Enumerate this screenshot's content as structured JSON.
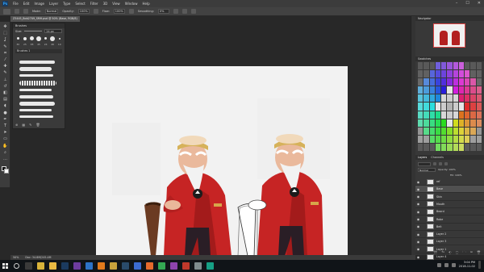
{
  "app": {
    "logo": "Ps"
  },
  "menu": [
    "File",
    "Edit",
    "Image",
    "Layer",
    "Type",
    "Select",
    "Filter",
    "3D",
    "View",
    "Window",
    "Help"
  ],
  "window_controls": {
    "minimize": "–",
    "maximize": "☐",
    "close": "✕"
  },
  "options": {
    "mode_label": "Mode:",
    "mode_value": "Normal",
    "opacity_label": "Opacity:",
    "opacity_value": "100%",
    "flow_label": "Flow:",
    "flow_value": "100%",
    "smoothing_label": "Smoothing:",
    "smoothing_value": "0%"
  },
  "document": {
    "tab_title": "Z3445_Bob2709_SMH.psd @ 50% (Base, RGB/8)"
  },
  "tools": [
    {
      "name": "move-tool-icon",
      "glyph": "✥"
    },
    {
      "name": "marquee-tool-icon",
      "glyph": "⬚"
    },
    {
      "name": "lasso-tool-icon",
      "glyph": "ʆ"
    },
    {
      "name": "quick-select-tool-icon",
      "glyph": "✎"
    },
    {
      "name": "crop-tool-icon",
      "glyph": "⌗"
    },
    {
      "name": "eyedropper-tool-icon",
      "glyph": "⁄"
    },
    {
      "name": "healing-tool-icon",
      "glyph": "✚"
    },
    {
      "name": "brush-tool-icon",
      "glyph": "✎"
    },
    {
      "name": "clone-stamp-tool-icon",
      "glyph": "⊥"
    },
    {
      "name": "history-brush-tool-icon",
      "glyph": "↺"
    },
    {
      "name": "eraser-tool-icon",
      "glyph": "◧"
    },
    {
      "name": "gradient-tool-icon",
      "glyph": "▤"
    },
    {
      "name": "blur-tool-icon",
      "glyph": "◖"
    },
    {
      "name": "dodge-tool-icon",
      "glyph": "●"
    },
    {
      "name": "pen-tool-icon",
      "glyph": "✒"
    },
    {
      "name": "type-tool-icon",
      "glyph": "T"
    },
    {
      "name": "path-select-tool-icon",
      "glyph": "➤"
    },
    {
      "name": "shape-tool-icon",
      "glyph": "▭"
    },
    {
      "name": "hand-tool-icon",
      "glyph": "✋"
    },
    {
      "name": "zoom-tool-icon",
      "glyph": "⌕"
    },
    {
      "name": "more-tools-icon",
      "glyph": "…"
    }
  ],
  "brushes_panel": {
    "title": "Brushes",
    "size_label": "Size:",
    "size_value": "24 px",
    "tip_sizes": [
      "30",
      "25",
      "38",
      "45",
      "24",
      "46",
      "10"
    ],
    "group_name": "Brushes 1",
    "footer": [
      "⊕",
      "▦",
      "✎",
      "🗑"
    ]
  },
  "right_panels": {
    "navigator_title": "Navigator",
    "swatches_title": "Swatches",
    "layers_tab": "Layers",
    "channels_tab": "Channels",
    "blend_mode": "Normal",
    "opacity_label": "Opacity: 100%",
    "fill_label": "Fill: 100%",
    "layers": [
      {
        "name": "ref",
        "selected": false
      },
      {
        "name": "Base",
        "selected": true
      },
      {
        "name": "Skin",
        "selected": false
      },
      {
        "name": "Mouth",
        "selected": false
      },
      {
        "name": "Beard",
        "selected": false
      },
      {
        "name": "Robe",
        "selected": false
      },
      {
        "name": "Belt",
        "selected": false
      },
      {
        "name": "Layer 2",
        "selected": false
      },
      {
        "name": "Layer 3",
        "selected": false
      },
      {
        "name": "Layer 1",
        "selected": false
      },
      {
        "name": "Layer 4",
        "selected": false
      }
    ],
    "footer_icons": [
      "⛓",
      "fx",
      "◐",
      "▢",
      "🗀",
      "⊞",
      "🗑"
    ]
  },
  "status": {
    "zoom": "50%",
    "doc_size": "Doc: 34.8M/245.4M"
  },
  "taskbar": {
    "apps": [
      {
        "name": "task-view-icon",
        "color": "#3a3a3a"
      },
      {
        "name": "chrome-icon",
        "color": "#d8b33a"
      },
      {
        "name": "file-explorer-icon",
        "color": "#e9b942"
      },
      {
        "name": "photoshop-taskbar-icon",
        "color": "#1b3a5e"
      },
      {
        "name": "media-icon",
        "color": "#6d3c9e"
      },
      {
        "name": "mail-icon",
        "color": "#2d73c7"
      },
      {
        "name": "vlc-icon",
        "color": "#e07a1c"
      },
      {
        "name": "folder-icon",
        "color": "#c8a23c"
      },
      {
        "name": "steam-icon",
        "color": "#2a4b6b"
      },
      {
        "name": "app-blue-icon",
        "color": "#3b6bd1"
      },
      {
        "name": "app-orange-icon",
        "color": "#e66a2c"
      },
      {
        "name": "app-green-icon",
        "color": "#34a853"
      },
      {
        "name": "app-purple-icon",
        "color": "#8e44ad"
      },
      {
        "name": "app-red-icon",
        "color": "#c0392b"
      },
      {
        "name": "app-gray-icon",
        "color": "#7f8c8d"
      },
      {
        "name": "app-teal-icon",
        "color": "#16a085"
      }
    ],
    "time": "3:04 PM",
    "date": "2018-11-02"
  }
}
